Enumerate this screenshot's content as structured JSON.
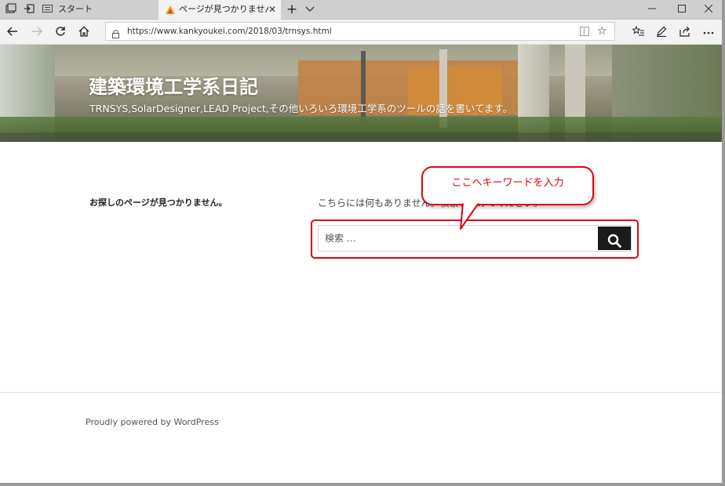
{
  "browser": {
    "tabs": [
      {
        "label": "スタート"
      },
      {
        "label": "ページが見つかりませんでし"
      }
    ],
    "address_url": "https://www.kankyoukei.com/2018/03/trnsys.html",
    "icons": {
      "tab_preview": "tab-preview-icon",
      "set_aside": "set-aside-tabs-icon",
      "back": "back-arrow-icon",
      "forward": "forward-arrow-icon",
      "refresh": "refresh-icon",
      "home": "home-icon",
      "favorites": "favorites-star-icon",
      "hub": "hub-icon",
      "notes": "pen-icon",
      "share": "share-icon",
      "more": "more-icon"
    }
  },
  "site": {
    "title": "建築環境工学系日記",
    "description": "TRNSYS,SolarDesigner,LEAD Project,その他いろいろ環境工学系のツールの話を書いてます。"
  },
  "content": {
    "not_found_heading": "お探しのページが見つかりません。",
    "message": "こちらには何もありません。検索してみてください。",
    "search_placeholder": "検索 …"
  },
  "annotation": {
    "callout_text": "ここへキーワードを入力",
    "color": "#e60012"
  },
  "footer": {
    "text": "Proudly powered by WordPress"
  }
}
